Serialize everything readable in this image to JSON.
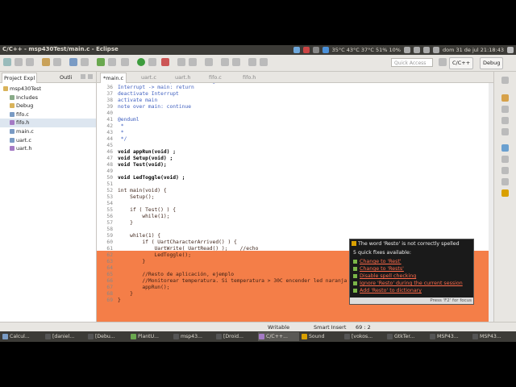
{
  "window": {
    "title": "C/C++ - msp430Test/main.c - Eclipse"
  },
  "tray": {
    "weather": "35°C 43°C 37°C 51% 10%",
    "clock": "dom 31 de jul 21:18:43",
    "icon_color": "#6fa8dc"
  },
  "toolbar": {
    "quick_access": "Quick Access",
    "persp_cpp": "C/C++",
    "persp_debug": "Debug"
  },
  "left": {
    "tabs": [
      "Project Expl",
      "Outli"
    ],
    "tree": [
      {
        "label": "msp430Test",
        "indent": 0,
        "icon": "folder-icon"
      },
      {
        "label": "Includes",
        "indent": 1,
        "icon": "includes-icon"
      },
      {
        "label": "Debug",
        "indent": 1,
        "icon": "folder-icon"
      },
      {
        "label": "fifo.c",
        "indent": 1,
        "icon": "c-file-icon"
      },
      {
        "label": "fifo.h",
        "indent": 1,
        "icon": "h-file-icon",
        "selected": true
      },
      {
        "label": "main.c",
        "indent": 1,
        "icon": "c-file-icon"
      },
      {
        "label": "uart.c",
        "indent": 1,
        "icon": "c-file-icon"
      },
      {
        "label": "uart.h",
        "indent": 1,
        "icon": "h-file-icon"
      }
    ]
  },
  "editor": {
    "tabs": [
      "*main.c",
      "uart.c",
      "uart.h",
      "fifo.c",
      "fifo.h"
    ],
    "lines": [
      {
        "n": "35",
        "t": "note over Interrupt: doSomething()",
        "cls": "plain"
      },
      {
        "n": "36",
        "t": "Interrupt -> main: return",
        "cls": "plain"
      },
      {
        "n": "37",
        "t": "deactivate Interrupt",
        "cls": "plain"
      },
      {
        "n": "38",
        "t": "activate main",
        "cls": "plain"
      },
      {
        "n": "39",
        "t": "note over main: continue",
        "cls": "plain"
      },
      {
        "n": "40",
        "t": "",
        "cls": "plain"
      },
      {
        "n": "41",
        "t": "@enduml",
        "cls": "plain"
      },
      {
        "n": "42",
        "t": " *",
        "cls": "plain"
      },
      {
        "n": "43",
        "t": " *",
        "cls": "plain"
      },
      {
        "n": "44",
        "t": " */",
        "cls": "plain"
      },
      {
        "n": "45",
        "t": "",
        "cls": ""
      },
      {
        "n": "46",
        "t": "void appRun(void) ;",
        "cls": "kw"
      },
      {
        "n": "47",
        "t": "void Setup(void) ;",
        "cls": "kw"
      },
      {
        "n": "48",
        "t": "void Test(void);",
        "cls": "kw"
      },
      {
        "n": "49",
        "t": "",
        "cls": ""
      },
      {
        "n": "50",
        "t": "void LedToggle(void) ;",
        "cls": "kw"
      },
      {
        "n": "51",
        "t": "",
        "cls": ""
      },
      {
        "n": "52",
        "t": "int main(void) {",
        "cls": "hl"
      },
      {
        "n": "53",
        "t": "    Setup();",
        "cls": "hl"
      },
      {
        "n": "54",
        "t": "",
        "cls": "hl"
      },
      {
        "n": "55",
        "t": "    if ( Test() ) {",
        "cls": "hl"
      },
      {
        "n": "56",
        "t": "        while(1);",
        "cls": "hl"
      },
      {
        "n": "57",
        "t": "    }",
        "cls": "hl"
      },
      {
        "n": "58",
        "t": "",
        "cls": "hl"
      },
      {
        "n": "59",
        "t": "    while(1) {",
        "cls": "hl"
      },
      {
        "n": "60",
        "t": "        if ( UartCharacterArrived() ) {",
        "cls": "hl"
      },
      {
        "n": "61",
        "t": "            UartWrite( UartRead() );    //echo",
        "cls": "hl"
      },
      {
        "n": "62",
        "t": "            LedToggle();",
        "cls": "hl"
      },
      {
        "n": "63",
        "t": "        }",
        "cls": "hl"
      },
      {
        "n": "64",
        "t": "",
        "cls": "hl"
      },
      {
        "n": "65",
        "t": "        //Resto de aplicación, ejemplo",
        "cls": "hl"
      },
      {
        "n": "66",
        "t": "        //Monitorear temperatura. Si temperatura > 30C encender led naranja",
        "cls": "hl"
      },
      {
        "n": "67",
        "t": "        appRun();",
        "cls": "hl"
      },
      {
        "n": "68",
        "t": "    }",
        "cls": "hl"
      },
      {
        "n": "69",
        "t": "}",
        "cls": "hl"
      }
    ]
  },
  "popup": {
    "header": "The word 'Resto' is not correctly spelled",
    "subtitle": "5 quick fixes available:",
    "fixes": [
      "Change to 'Rest'",
      "Change to 'Rests'",
      "Disable spell checking",
      "Ignore 'Resto' during the current session",
      "Add 'Resto' to dictionary"
    ],
    "footer": "Press 'F2' for focus"
  },
  "status": {
    "writable": "Writable",
    "insert": "Smart Insert",
    "position": "69 : 2"
  },
  "taskbar": [
    "Calcul...",
    "[daniel...",
    "[Debu...",
    "PlantU...",
    "msp43...",
    "[Droid...",
    "C/C++...",
    "Sound",
    "[vokos...",
    "GtkTer...",
    "MSP43...",
    "MSP43..."
  ],
  "colors": {
    "highlight": "#f47e48",
    "link": "#ff6a4a"
  }
}
